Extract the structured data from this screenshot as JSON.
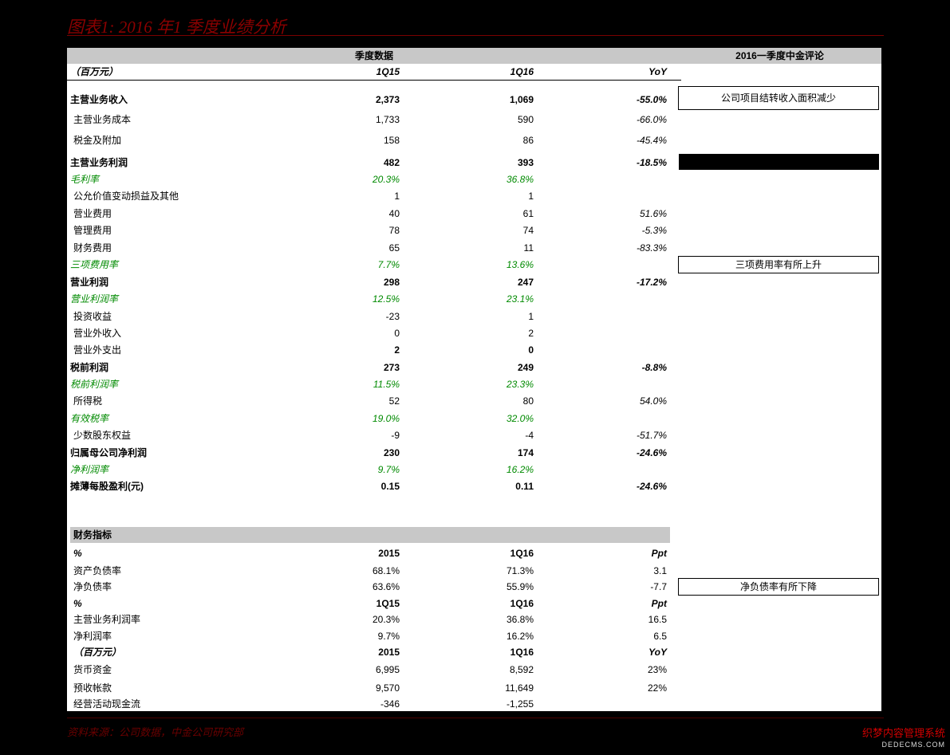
{
  "title": "图表1: 2016 年1 季度业绩分析",
  "header": {
    "quarterly": "季度数据",
    "comment": "2016一季度中金评论"
  },
  "colhdr": {
    "unit": "（百万元）",
    "c1": "1Q15",
    "c2": "1Q16",
    "c3": "YoY"
  },
  "rows": [
    {
      "label": "主营业务收入",
      "c1": "2,373",
      "c2": "1,069",
      "c3": "-55.0%"
    },
    {
      "label": "主营业务成本",
      "c1": "1,733",
      "c2": "590",
      "c3": "-66.0%"
    },
    {
      "label": "税金及附加",
      "c1": "158",
      "c2": "86",
      "c3": "-45.4%"
    },
    {
      "label": "主营业务利润",
      "c1": "482",
      "c2": "393",
      "c3": "-18.5%"
    },
    {
      "label": "毛利率",
      "c1": "20.3%",
      "c2": "36.8%",
      "c3": ""
    },
    {
      "label": "公允价值变动损益及其他",
      "c1": "1",
      "c2": "1",
      "c3": ""
    },
    {
      "label": "营业费用",
      "c1": "40",
      "c2": "61",
      "c3": "51.6%"
    },
    {
      "label": "管理费用",
      "c1": "78",
      "c2": "74",
      "c3": "-5.3%"
    },
    {
      "label": "财务费用",
      "c1": "65",
      "c2": "11",
      "c3": "-83.3%"
    },
    {
      "label": "三项费用率",
      "c1": "7.7%",
      "c2": "13.6%",
      "c3": ""
    },
    {
      "label": "营业利润",
      "c1": "298",
      "c2": "247",
      "c3": "-17.2%"
    },
    {
      "label": "营业利润率",
      "c1": "12.5%",
      "c2": "23.1%",
      "c3": ""
    },
    {
      "label": "投资收益",
      "c1": "-23",
      "c2": "1",
      "c3": ""
    },
    {
      "label": "营业外收入",
      "c1": "0",
      "c2": "2",
      "c3": ""
    },
    {
      "label": "营业外支出",
      "c1": "2",
      "c2": "0",
      "c3": ""
    },
    {
      "label": "税前利润",
      "c1": "273",
      "c2": "249",
      "c3": "-8.8%"
    },
    {
      "label": "税前利润率",
      "c1": "11.5%",
      "c2": "23.3%",
      "c3": ""
    },
    {
      "label": "所得税",
      "c1": "52",
      "c2": "80",
      "c3": "54.0%"
    },
    {
      "label": "有效税率",
      "c1": "19.0%",
      "c2": "32.0%",
      "c3": ""
    },
    {
      "label": "少数股东权益",
      "c1": "-9",
      "c2": "-4",
      "c3": "-51.7%"
    },
    {
      "label": "归属母公司净利润",
      "c1": "230",
      "c2": "174",
      "c3": "-24.6%"
    },
    {
      "label": "净利润率",
      "c1": "9.7%",
      "c2": "16.2%",
      "c3": ""
    },
    {
      "label": "摊薄每股盈利(元)",
      "c1": "0.15",
      "c2": "0.11",
      "c3": "-24.6%"
    }
  ],
  "financial": {
    "title": "财务指标",
    "rows": [
      {
        "label": "%",
        "c1": "2015",
        "c2": "1Q16",
        "c3": "Ppt"
      },
      {
        "label": "资产负债率",
        "c1": "68.1%",
        "c2": "71.3%",
        "c3": "3.1"
      },
      {
        "label": "净负债率",
        "c1": "63.6%",
        "c2": "55.9%",
        "c3": "-7.7"
      },
      {
        "label": "%",
        "c1": "1Q15",
        "c2": "1Q16",
        "c3": "Ppt"
      },
      {
        "label": "主营业务利润率",
        "c1": "20.3%",
        "c2": "36.8%",
        "c3": "16.5"
      },
      {
        "label": "净利润率",
        "c1": "9.7%",
        "c2": "16.2%",
        "c3": "6.5"
      },
      {
        "label": "（百万元）",
        "c1": "2015",
        "c2": "1Q16",
        "c3": "YoY"
      },
      {
        "label": "货币资金",
        "c1": "6,995",
        "c2": "8,592",
        "c3": "23%"
      },
      {
        "label": "预收帐款",
        "c1": "9,570",
        "c2": "11,649",
        "c3": "22%"
      },
      {
        "label": "经营活动现金流",
        "c1": "-346",
        "c2": "-1,255",
        "c3": ""
      }
    ]
  },
  "comments": {
    "revenue": "公司项目结转收入面积减少",
    "expense": "三项费用率有所上升",
    "debt": "净负债率有所下降"
  },
  "footer": "资料来源：公司数据，中金公司研究部",
  "watermark": {
    "line1": "织梦内容管理系统",
    "line2": "DEDECMS.COM"
  }
}
